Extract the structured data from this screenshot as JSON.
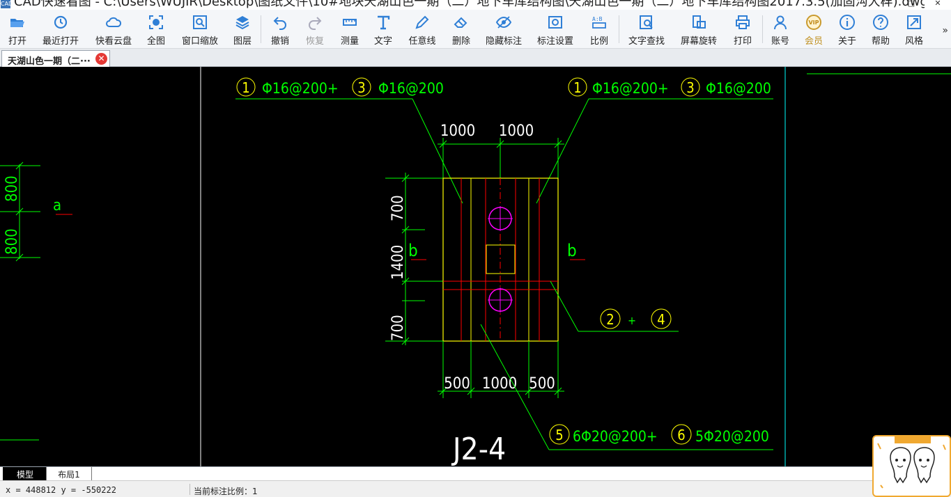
{
  "window": {
    "title": "CAD快速看图 - C:\\Users\\WUJIR\\Desktop\\图纸文件\\10#地块天湖山色一期（二）地下车库结构图\\天湖山色一期（二）地下车库结构图2017.3.5(加固沟大样).dwg",
    "app_icon": "CAD",
    "minimize": "—",
    "maximize": "□",
    "close": "✕"
  },
  "toolbar": {
    "items": [
      {
        "label": "打开",
        "icon": "folder-open-icon"
      },
      {
        "label": "最近打开",
        "icon": "recent-clock-icon"
      },
      {
        "label": "快看云盘",
        "icon": "cloud-icon"
      },
      {
        "label": "全图",
        "icon": "zoom-extents-icon"
      },
      {
        "label": "窗口缩放",
        "icon": "zoom-window-icon"
      },
      {
        "label": "图层",
        "icon": "layers-icon"
      },
      {
        "label": "撤销",
        "icon": "undo-icon"
      },
      {
        "label": "恢复",
        "icon": "redo-icon"
      },
      {
        "label": "测量",
        "icon": "ruler-icon"
      },
      {
        "label": "文字",
        "icon": "text-icon"
      },
      {
        "label": "任意线",
        "icon": "pencil-icon"
      },
      {
        "label": "删除",
        "icon": "eraser-icon"
      },
      {
        "label": "隐藏标注",
        "icon": "eye-icon"
      },
      {
        "label": "标注设置",
        "icon": "annotation-settings-icon"
      },
      {
        "label": "比例",
        "icon": "scale-icon"
      },
      {
        "label": "文字查找",
        "icon": "text-search-icon"
      },
      {
        "label": "屏幕旋转",
        "icon": "rotate-screen-icon"
      },
      {
        "label": "打印",
        "icon": "printer-icon"
      },
      {
        "label": "账号",
        "icon": "user-icon"
      },
      {
        "label": "会员",
        "icon": "vip-icon",
        "badge": "VIP"
      },
      {
        "label": "关于",
        "icon": "info-icon"
      },
      {
        "label": "帮助",
        "icon": "help-icon"
      },
      {
        "label": "风格",
        "icon": "style-icon"
      }
    ],
    "more": "»"
  },
  "doc_tab": {
    "label": "天湖山色一期（二···",
    "close": "✕"
  },
  "drawing": {
    "rebar_top_left_1": "1",
    "rebar_top_left_1_text": "Φ16@200+",
    "rebar_top_left_3": "3",
    "rebar_top_left_3_text": "Φ16@200",
    "rebar_top_right_1": "1",
    "rebar_top_right_1_text": "Φ16@200+",
    "rebar_top_right_3": "3",
    "rebar_top_right_3_text": "Φ16@200",
    "dim_top_a": "1000",
    "dim_top_b": "1000",
    "dim_left_a": "700",
    "dim_left_b": "1400",
    "dim_left_c": "700",
    "dim_bottom_a": "500",
    "dim_bottom_b": "1000",
    "dim_bottom_c": "500",
    "section_b_left": "b",
    "section_b_right": "b",
    "section_a": "a",
    "far_left_dim_a": "800",
    "far_left_dim_b": "800",
    "callout_2": "2",
    "callout_plus": "+",
    "callout_4": "4",
    "rebar_bottom_5": "5",
    "rebar_bottom_5_text": "6Φ20@200+",
    "rebar_bottom_6": "6",
    "rebar_bottom_6_text": "5Φ20@200",
    "footing_title": "J2-4",
    "colors": {
      "line_green": "#00ff00",
      "cyan": "#00ffff",
      "yellow": "#ffff00",
      "red": "#ff0000",
      "magenta": "#ff00ff",
      "white": "#ffffff"
    }
  },
  "layout_tabs": {
    "model": "模型",
    "layout1": "布局1"
  },
  "status": {
    "coords": "x = 448812  y = -550222",
    "scale": "当前标注比例：1"
  }
}
